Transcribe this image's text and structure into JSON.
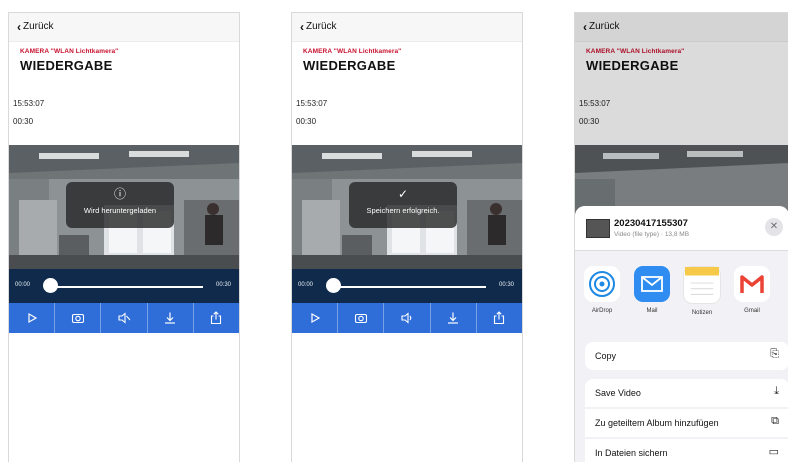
{
  "colors": {
    "brand_red": "#c8102e",
    "accent_blue": "#2f6ed8",
    "scrub_bg": "#0f2a4a"
  },
  "nav": {
    "back_label": "Zurück"
  },
  "header": {
    "camera": "KAMERA \"WLAN Lichtkamera\"",
    "title": "WIEDERGABE"
  },
  "meta": {
    "clock": "15:53:07",
    "duration": "00:30"
  },
  "player": {
    "time_start": "00:00",
    "time_end": "00:30",
    "progress": 0.0,
    "controls": [
      "play-icon",
      "snapshot-icon",
      "mute-icon",
      "download-icon",
      "share-icon"
    ]
  },
  "screens": [
    {
      "toast_icon": "info-icon",
      "toast_text": "Wird heruntergeladen"
    },
    {
      "toast_icon": "checkmark-icon",
      "toast_text": "Speichern erfolgreich."
    }
  ],
  "share_sheet": {
    "file_name": "20230417155307",
    "file_info": "Video (file type) · 13,8 MB",
    "apps": [
      {
        "label": "AirDrop",
        "icon": "airdrop-icon"
      },
      {
        "label": "Mail",
        "icon": "mail-icon"
      },
      {
        "label": "Notizen",
        "icon": "notes-icon"
      },
      {
        "label": "Gmail",
        "icon": "gmail-icon"
      }
    ],
    "actions": [
      {
        "label": "Copy",
        "icon": "copy-icon"
      },
      {
        "label": "Save Video",
        "icon": "save-video-icon"
      },
      {
        "label": "Zu geteiltem Album hinzufügen",
        "icon": "shared-album-icon"
      },
      {
        "label": "In Dateien sichern",
        "icon": "folder-icon"
      }
    ]
  }
}
